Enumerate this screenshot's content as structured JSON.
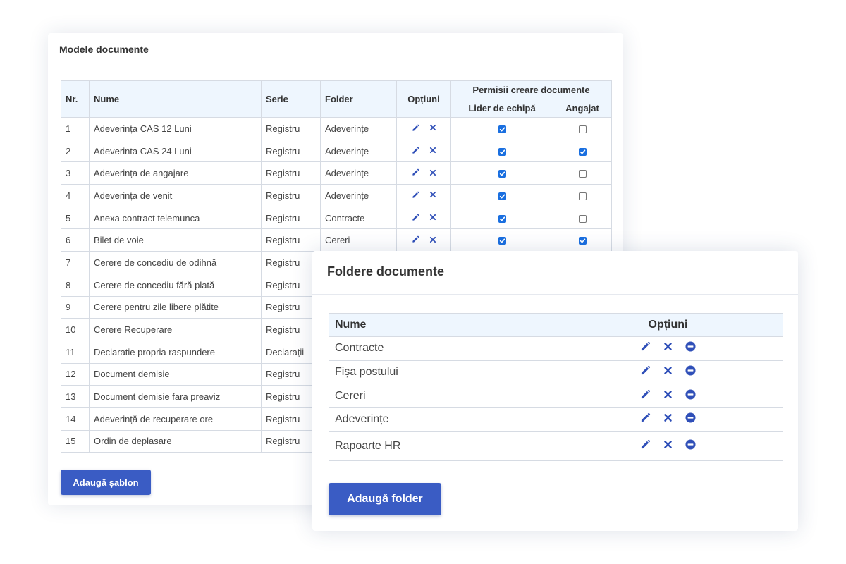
{
  "models": {
    "title": "Modele documente",
    "headers": {
      "nr": "Nr.",
      "name": "Nume",
      "series": "Serie",
      "folder": "Folder",
      "options": "Opțiuni",
      "permissions": "Permisii creare documente",
      "leader": "Lider de echipă",
      "employee": "Angajat"
    },
    "rows": [
      {
        "nr": "1",
        "name": "Adeverința CAS 12 Luni",
        "series": "Registru",
        "folder": "Adeverințe",
        "leader": true,
        "employee": false
      },
      {
        "nr": "2",
        "name": "Adeverinta CAS 24 Luni",
        "series": "Registru",
        "folder": "Adeverințe",
        "leader": true,
        "employee": true
      },
      {
        "nr": "3",
        "name": "Adeverința de angajare",
        "series": "Registru",
        "folder": "Adeverințe",
        "leader": true,
        "employee": false
      },
      {
        "nr": "4",
        "name": "Adeverința de venit",
        "series": "Registru",
        "folder": "Adeverințe",
        "leader": true,
        "employee": false
      },
      {
        "nr": "5",
        "name": "Anexa contract telemunca",
        "series": "Registru",
        "folder": "Contracte",
        "leader": true,
        "employee": false
      },
      {
        "nr": "6",
        "name": "Bilet de voie",
        "series": "Registru",
        "folder": "Cereri",
        "leader": true,
        "employee": true
      },
      {
        "nr": "7",
        "name": "Cerere de concediu de odihnă",
        "series": "Registru",
        "folder": "",
        "leader": null,
        "employee": null
      },
      {
        "nr": "8",
        "name": "Cerere de concediu fără plată",
        "series": "Registru",
        "folder": "",
        "leader": null,
        "employee": null
      },
      {
        "nr": "9",
        "name": "Cerere pentru zile libere plătite",
        "series": "Registru",
        "folder": "",
        "leader": null,
        "employee": null
      },
      {
        "nr": "10",
        "name": "Cerere Recuperare",
        "series": "Registru",
        "folder": "",
        "leader": null,
        "employee": null
      },
      {
        "nr": "11",
        "name": "Declaratie propria raspundere",
        "series": "Declarații",
        "folder": "",
        "leader": null,
        "employee": null
      },
      {
        "nr": "12",
        "name": "Document demisie",
        "series": "Registru",
        "folder": "",
        "leader": null,
        "employee": null
      },
      {
        "nr": "13",
        "name": "Document demisie fara preaviz",
        "series": "Registru",
        "folder": "",
        "leader": null,
        "employee": null
      },
      {
        "nr": "14",
        "name": "Adeverință de recuperare ore",
        "series": "Registru",
        "folder": "",
        "leader": null,
        "employee": null
      },
      {
        "nr": "15",
        "name": "Ordin de deplasare",
        "series": "Registru",
        "folder": "",
        "leader": null,
        "employee": null
      }
    ],
    "add_button": "Adaugă șablon"
  },
  "folders": {
    "title": "Foldere documente",
    "headers": {
      "name": "Nume",
      "options": "Opțiuni"
    },
    "rows": [
      {
        "name": "Contracte"
      },
      {
        "name": "Fișa postului"
      },
      {
        "name": "Cereri"
      },
      {
        "name": "Adeverințe"
      },
      {
        "name": "Rapoarte HR"
      }
    ],
    "add_button": "Adaugă folder"
  },
  "icons": {
    "edit": "pencil-icon",
    "delete": "x-icon",
    "disable": "minus-circle-icon"
  },
  "colors": {
    "accent": "#3a5cc4",
    "icon": "#2f4fb8",
    "checkbox": "#1a6fe0",
    "header_bg": "#eef6fe"
  }
}
